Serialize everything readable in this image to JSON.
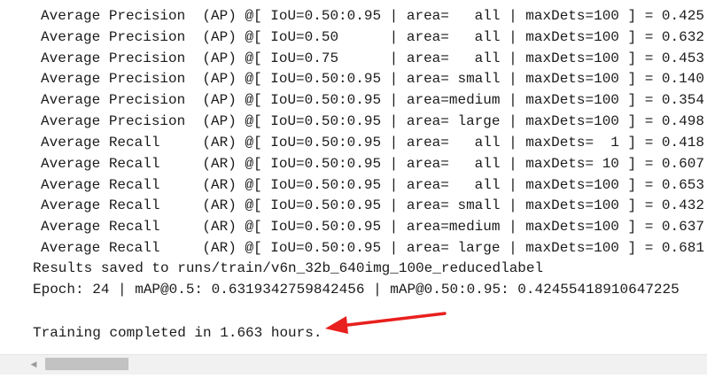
{
  "output": {
    "metrics": [
      "Average Precision  (AP) @[ IoU=0.50:0.95 | area=   all | maxDets=100 ] = 0.425",
      "Average Precision  (AP) @[ IoU=0.50      | area=   all | maxDets=100 ] = 0.632",
      "Average Precision  (AP) @[ IoU=0.75      | area=   all | maxDets=100 ] = 0.453",
      "Average Precision  (AP) @[ IoU=0.50:0.95 | area= small | maxDets=100 ] = 0.140",
      "Average Precision  (AP) @[ IoU=0.50:0.95 | area=medium | maxDets=100 ] = 0.354",
      "Average Precision  (AP) @[ IoU=0.50:0.95 | area= large | maxDets=100 ] = 0.498",
      "Average Recall     (AR) @[ IoU=0.50:0.95 | area=   all | maxDets=  1 ] = 0.418",
      "Average Recall     (AR) @[ IoU=0.50:0.95 | area=   all | maxDets= 10 ] = 0.607",
      "Average Recall     (AR) @[ IoU=0.50:0.95 | area=   all | maxDets=100 ] = 0.653",
      "Average Recall     (AR) @[ IoU=0.50:0.95 | area= small | maxDets=100 ] = 0.432",
      "Average Recall     (AR) @[ IoU=0.50:0.95 | area=medium | maxDets=100 ] = 0.637",
      "Average Recall     (AR) @[ IoU=0.50:0.95 | area= large | maxDets=100 ] = 0.681"
    ],
    "results_saved": "Results saved to runs/train/v6n_32b_640img_100e_reducedlabel",
    "epoch_summary": "Epoch: 24 | mAP@0.5: 0.6319342759842456 | mAP@0.50:0.95: 0.42455418910647225",
    "training_completed": "Training completed in 1.663 hours."
  },
  "scrollbar": {
    "left_arrow_icon": "caret-left-icon",
    "scroll_position": 0
  },
  "annotation": {
    "arrow_color": "#e8201e"
  }
}
